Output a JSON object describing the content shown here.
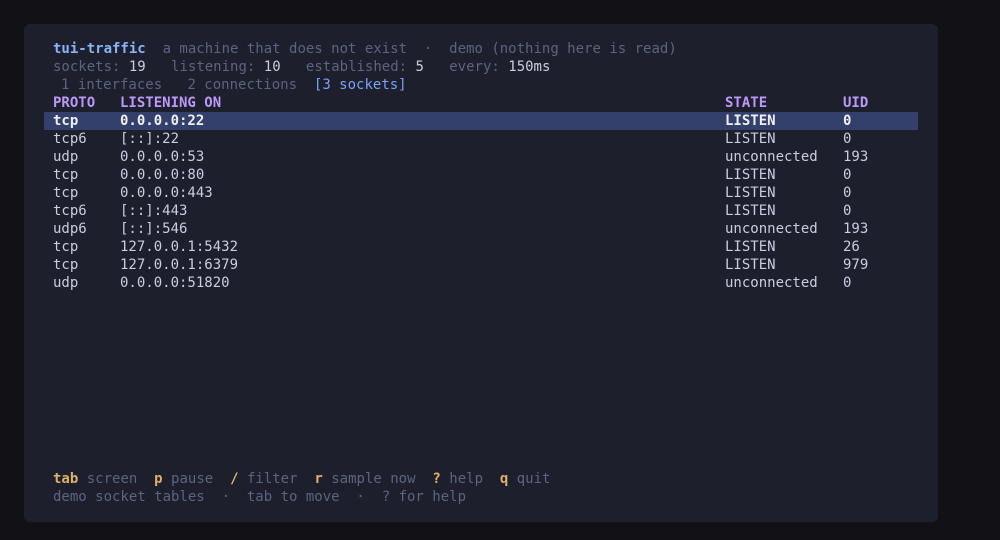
{
  "header": {
    "app_name": "tui-traffic",
    "subtitle": "a machine that does not exist",
    "sep": "·",
    "mode": "demo (nothing here is read)"
  },
  "stats": {
    "sockets_label": "sockets:",
    "sockets": "19",
    "listening_label": "listening:",
    "listening": "10",
    "established_label": "established:",
    "established": "5",
    "every_label": "every:",
    "every": "150ms"
  },
  "tabs": [
    {
      "label": "1 interfaces"
    },
    {
      "label": "2 connections"
    },
    {
      "label": "[3 sockets]"
    }
  ],
  "table": {
    "columns": [
      "PROTO",
      "LISTENING ON",
      "STATE",
      "UID"
    ],
    "rows": [
      {
        "proto": "tcp",
        "addr": "0.0.0.0:22",
        "state": "LISTEN",
        "uid": "0"
      },
      {
        "proto": "tcp6",
        "addr": "[::]:22",
        "state": "LISTEN",
        "uid": "0"
      },
      {
        "proto": "udp",
        "addr": "0.0.0.0:53",
        "state": "unconnected",
        "uid": "193"
      },
      {
        "proto": "tcp",
        "addr": "0.0.0.0:80",
        "state": "LISTEN",
        "uid": "0"
      },
      {
        "proto": "tcp",
        "addr": "0.0.0.0:443",
        "state": "LISTEN",
        "uid": "0"
      },
      {
        "proto": "tcp6",
        "addr": "[::]:443",
        "state": "LISTEN",
        "uid": "0"
      },
      {
        "proto": "udp6",
        "addr": "[::]:546",
        "state": "unconnected",
        "uid": "193"
      },
      {
        "proto": "tcp",
        "addr": "127.0.0.1:5432",
        "state": "LISTEN",
        "uid": "26"
      },
      {
        "proto": "tcp",
        "addr": "127.0.0.1:6379",
        "state": "LISTEN",
        "uid": "979"
      },
      {
        "proto": "udp",
        "addr": "0.0.0.0:51820",
        "state": "unconnected",
        "uid": "0"
      }
    ]
  },
  "footer": {
    "keys": [
      {
        "key": "tab",
        "label": "screen"
      },
      {
        "key": "p",
        "label": "pause"
      },
      {
        "key": "/",
        "label": "filter"
      },
      {
        "key": "r",
        "label": "sample now"
      },
      {
        "key": "?",
        "label": "help"
      },
      {
        "key": "q",
        "label": "quit"
      }
    ],
    "hint": "demo socket tables  ·  tab to move  ·  ? for help"
  },
  "colors": {
    "background": "#1d1f2d",
    "selected_row": "#33406b",
    "header_text": "#bb9af7",
    "key_text": "#e0af68",
    "title_text": "#8ab4f8"
  }
}
